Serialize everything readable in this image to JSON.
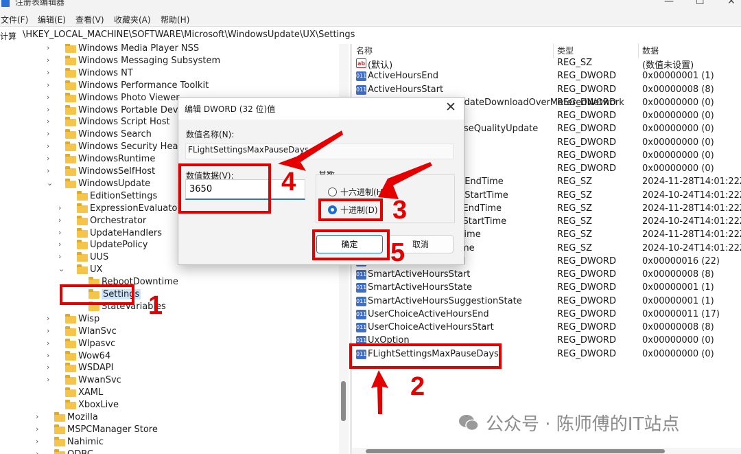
{
  "window": {
    "title": "注册表编辑器"
  },
  "menu": [
    "文件(F)",
    "编辑(E)",
    "查看(V)",
    "收藏夹(A)",
    "帮助(H)"
  ],
  "address": {
    "prefix": "计算",
    "path": "\\HKEY_LOCAL_MACHINE\\SOFTWARE\\Microsoft\\WindowsUpdate\\UX\\Settings"
  },
  "tree": [
    {
      "label": "Windows Media Player NSS",
      "depth": 1,
      "chev": "right"
    },
    {
      "label": "Windows Messaging Subsystem",
      "depth": 1,
      "chev": "right"
    },
    {
      "label": "Windows NT",
      "depth": 1,
      "chev": "right"
    },
    {
      "label": "Windows Performance Toolkit",
      "depth": 1,
      "chev": "right"
    },
    {
      "label": "Windows Photo Viewer",
      "depth": 1,
      "chev": "right"
    },
    {
      "label": "Windows Portable Devices",
      "depth": 1,
      "chev": "right"
    },
    {
      "label": "Windows Script Host",
      "depth": 1,
      "chev": "right"
    },
    {
      "label": "Windows Search",
      "depth": 1,
      "chev": "right"
    },
    {
      "label": "Windows Security Health",
      "depth": 1,
      "chev": "right"
    },
    {
      "label": "WindowsRuntime",
      "depth": 1,
      "chev": "right"
    },
    {
      "label": "WindowsSelfHost",
      "depth": 1,
      "chev": "right"
    },
    {
      "label": "WindowsUpdate",
      "depth": 1,
      "chev": "down"
    },
    {
      "label": "EditionSettings",
      "depth": 2,
      "chev": ""
    },
    {
      "label": "ExpressionEvaluators",
      "depth": 2,
      "chev": "right"
    },
    {
      "label": "Orchestrator",
      "depth": 2,
      "chev": "right"
    },
    {
      "label": "UpdateHandlers",
      "depth": 2,
      "chev": "right"
    },
    {
      "label": "UpdatePolicy",
      "depth": 2,
      "chev": "right"
    },
    {
      "label": "UUS",
      "depth": 2,
      "chev": "right"
    },
    {
      "label": "UX",
      "depth": 2,
      "chev": "down"
    },
    {
      "label": "RebootDowntime",
      "depth": 3,
      "chev": ""
    },
    {
      "label": "Settings",
      "depth": 3,
      "chev": "",
      "selected": true
    },
    {
      "label": "StateVariables",
      "depth": 3,
      "chev": ""
    },
    {
      "label": "Wisp",
      "depth": 1,
      "chev": "right"
    },
    {
      "label": "WlanSvc",
      "depth": 1,
      "chev": "right"
    },
    {
      "label": "Wlpasvc",
      "depth": 1,
      "chev": "right"
    },
    {
      "label": "Wow64",
      "depth": 1,
      "chev": "right"
    },
    {
      "label": "WSDAPI",
      "depth": 1,
      "chev": "right"
    },
    {
      "label": "WwanSvc",
      "depth": 1,
      "chev": "right"
    },
    {
      "label": "XAML",
      "depth": 1,
      "chev": ""
    },
    {
      "label": "XboxLive",
      "depth": 1,
      "chev": ""
    },
    {
      "label": "Mozilla",
      "depth": 0,
      "chev": "right"
    },
    {
      "label": "MSPCManager Store",
      "depth": 0,
      "chev": "right"
    },
    {
      "label": "Nahimic",
      "depth": 0,
      "chev": "right"
    },
    {
      "label": "ODBC",
      "depth": 0,
      "chev": "right"
    }
  ],
  "list": {
    "headers": {
      "name": "名称",
      "type": "类型",
      "data": "数据"
    },
    "rows": [
      {
        "name": "(默认)",
        "type": "REG_SZ",
        "data": "(数值未设置)",
        "icon": "sz"
      },
      {
        "name": "ActiveHoursEnd",
        "type": "REG_DWORD",
        "data": "0x00000001 (1)",
        "icon": "dw"
      },
      {
        "name": "ActiveHoursStart",
        "type": "REG_DWORD",
        "data": "0x00000008 (8)",
        "icon": "dw"
      },
      {
        "name": "AllowAutoWindowsUpdateDownloadOverMeteredNetwork",
        "type": "REG_DWORD",
        "data": "0x00000000 (0)",
        "icon": "dw"
      },
      {
        "name": "",
        "type": "REG_DWORD",
        "data": "0x00000000 (0)",
        "icon": "dw"
      },
      {
        "name": "FlightSettingsMaxPauseQualityUpdate",
        "type": "REG_DWORD",
        "data": "0x00000000 (0)",
        "icon": "dw"
      },
      {
        "name": "",
        "type": "REG_DWORD",
        "data": "0x00000000 (0)",
        "icon": "dw"
      },
      {
        "name": "",
        "type": "REG_DWORD",
        "data": "0x00000000 (0)",
        "icon": "dw"
      },
      {
        "name": "",
        "type": "REG_DWORD",
        "data": "0x00000000 (0)",
        "icon": "dw"
      },
      {
        "name": "PauseFeatureUpdatesEndTime",
        "type": "REG_SZ",
        "data": "2024-11-28T14:01:22Z",
        "icon": "sz"
      },
      {
        "name": "PauseFeatureUpdatesStartTime",
        "type": "REG_SZ",
        "data": "2024-10-24T14:01:22Z",
        "icon": "sz"
      },
      {
        "name": "PauseQualityUpdatesEndTime",
        "type": "REG_SZ",
        "data": "2024-11-28T14:01:22Z",
        "icon": "sz"
      },
      {
        "name": "PauseQualityUpdatesStartTime",
        "type": "REG_SZ",
        "data": "2024-10-24T14:01:22Z",
        "icon": "sz"
      },
      {
        "name": "PauseUpdatesExpiryTime",
        "type": "REG_SZ",
        "data": "2024-11-28T14:01:22Z",
        "icon": "sz"
      },
      {
        "name": "PauseUpdatesStartTime",
        "type": "REG_SZ",
        "data": "2024-10-24T14:01:22Z",
        "icon": "sz"
      },
      {
        "name": "SmartActiveHoursEnd",
        "type": "REG_DWORD",
        "data": "0x00000016 (22)",
        "icon": "dw"
      },
      {
        "name": "SmartActiveHoursStart",
        "type": "REG_DWORD",
        "data": "0x00000008 (8)",
        "icon": "dw"
      },
      {
        "name": "SmartActiveHoursState",
        "type": "REG_DWORD",
        "data": "0x00000001 (1)",
        "icon": "dw"
      },
      {
        "name": "SmartActiveHoursSuggestionState",
        "type": "REG_DWORD",
        "data": "0x00000001 (1)",
        "icon": "dw"
      },
      {
        "name": "UserChoiceActiveHoursEnd",
        "type": "REG_DWORD",
        "data": "0x00000011 (17)",
        "icon": "dw"
      },
      {
        "name": "UserChoiceActiveHoursStart",
        "type": "REG_DWORD",
        "data": "0x00000008 (8)",
        "icon": "dw"
      },
      {
        "name": "UxOption",
        "type": "REG_DWORD",
        "data": "0x00000000 (0)",
        "icon": "dw"
      },
      {
        "name": "FLightSettingsMaxPauseDays",
        "type": "REG_DWORD",
        "data": "0x00000000 (0)",
        "icon": "dw"
      }
    ]
  },
  "dialog": {
    "title": "编辑 DWORD (32 位)值",
    "name_label": "数值名称(N):",
    "name_value": "FLightSettingsMaxPauseDays",
    "data_label": "数值数据(V):",
    "data_value": "3650",
    "base_label": "基数",
    "radio_hex": "十六进制(H)",
    "radio_dec": "十进制(D)",
    "selected_base": "decimal",
    "ok": "确定",
    "cancel": "取消",
    "close_glyph": "✕"
  },
  "annotations": {
    "n1": "1",
    "n2": "2",
    "n3": "3",
    "n4": "4",
    "n5": "5",
    "color": "#e50000"
  },
  "watermark": "公众号 · 陈师傅的IT站点"
}
